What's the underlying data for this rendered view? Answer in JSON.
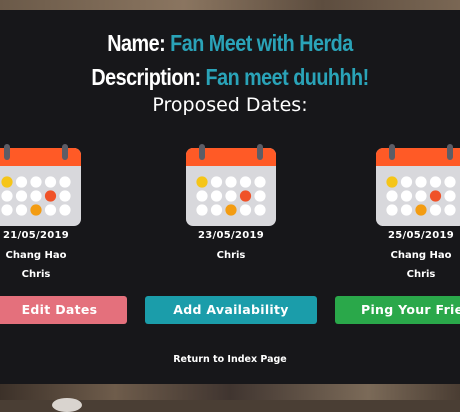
{
  "event": {
    "name_label": "Name:",
    "name_value": "Fan Meet with Herda",
    "description_label": "Description:",
    "description_value": "Fan meet duuhhh!"
  },
  "proposed_dates_heading": "Proposed Dates:",
  "dates": [
    {
      "date": "21/05/2019",
      "attendees": [
        "Chang Hao",
        "Chris"
      ]
    },
    {
      "date": "23/05/2019",
      "attendees": [
        "Chris"
      ]
    },
    {
      "date": "25/05/2019",
      "attendees": [
        "Chang Hao",
        "Chris"
      ]
    }
  ],
  "buttons": {
    "edit_dates": "Edit Dates",
    "add_availability": "Add Availability",
    "ping_friends": "Ping Your Friends"
  },
  "return_link": "Return to Index Page",
  "icons": {
    "calendar": "calendar-icon"
  },
  "colors": {
    "accent_teal": "#2aa3b8",
    "edit_button": "#e4707c",
    "add_button": "#1b9daa",
    "ping_button": "#2aa84a",
    "calendar_header": "#ff5a26",
    "calendar_yellow_dot": "#f5c518",
    "calendar_orange_dot": "#f39c12",
    "calendar_red_dot": "#f05228"
  }
}
